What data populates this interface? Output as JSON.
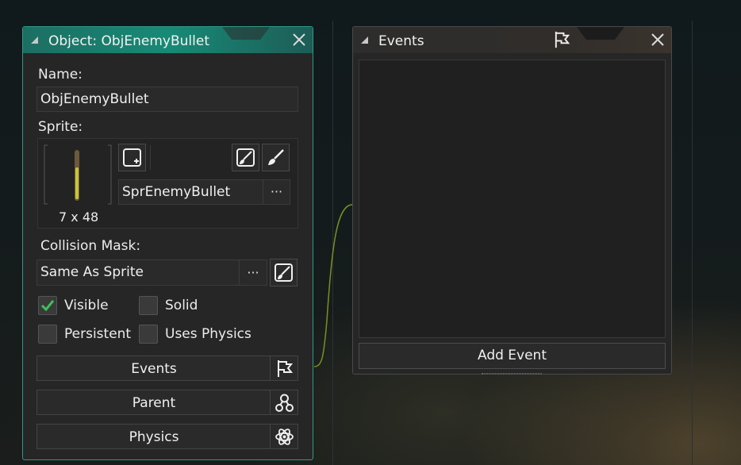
{
  "object_panel": {
    "title": "Object: ObjEnemyBullet",
    "name_label": "Name:",
    "name_value": "ObjEnemyBullet",
    "sprite_label": "Sprite:",
    "sprite_name": "SprEnemyBullet",
    "sprite_size": "7 x 48",
    "sprite_more": "···",
    "mask_label": "Collision Mask:",
    "mask_value": "Same As Sprite",
    "mask_more": "···",
    "checkboxes": [
      {
        "label": "Visible",
        "checked": true
      },
      {
        "label": "Solid",
        "checked": false
      },
      {
        "label": "Persistent",
        "checked": false
      },
      {
        "label": "Uses Physics",
        "checked": false
      }
    ],
    "buttons": {
      "events": "Events",
      "parent": "Parent",
      "physics": "Physics"
    },
    "icons": [
      "grip-icon",
      "close-icon",
      "new-sprite-icon",
      "edit-sprite-icon",
      "edit-image-icon",
      "flag-icon",
      "parent-icon",
      "physics-icon"
    ]
  },
  "events_panel": {
    "title": "Events",
    "add_event": "Add Event",
    "events": []
  },
  "colors": {
    "accent_teal": "#178a76",
    "check_green": "#3fbf5a",
    "link_line": "#7a8f25"
  }
}
